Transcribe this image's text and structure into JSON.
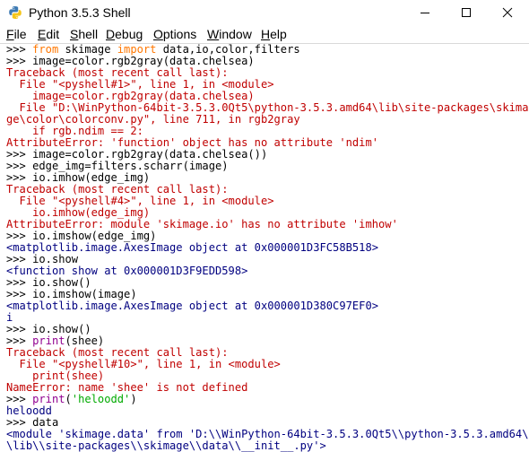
{
  "window": {
    "title": "Python 3.5.3 Shell",
    "icon": "python-icon",
    "controls": [
      "minimize-icon",
      "maximize-icon",
      "close-icon"
    ]
  },
  "menubar": {
    "items": [
      {
        "label": "File",
        "underline": "F"
      },
      {
        "label": "Edit",
        "underline": "E"
      },
      {
        "label": "Shell",
        "underline": "S"
      },
      {
        "label": "Debug",
        "underline": "D"
      },
      {
        "label": "Options",
        "underline": "O"
      },
      {
        "label": "Window",
        "underline": "W"
      },
      {
        "label": "Help",
        "underline": "H"
      }
    ]
  },
  "colors": {
    "prompt": "#000000",
    "keyword": "#ff7700",
    "builtin": "#900090",
    "string": "#00aa00",
    "stdout": "#000080",
    "error": "#c00000"
  },
  "shell": {
    "lines": [
      {
        "kind": "input",
        "prompt": ">>> ",
        "parts": [
          {
            "t": "from",
            "c": "kw"
          },
          {
            "t": " skimage "
          },
          {
            "t": "import",
            "c": "kw"
          },
          {
            "t": " data,io,color,filters"
          }
        ]
      },
      {
        "kind": "input",
        "prompt": ">>> ",
        "parts": [
          {
            "t": "image=color.rgb2gray(data.chelsea)"
          }
        ]
      },
      {
        "kind": "error",
        "text": "Traceback (most recent call last):"
      },
      {
        "kind": "error",
        "text": "  File \"<pyshell#1>\", line 1, in <module>"
      },
      {
        "kind": "error",
        "text": "    image=color.rgb2gray(data.chelsea)"
      },
      {
        "kind": "error",
        "text": "  File \"D:\\WinPython-64bit-3.5.3.0Qt5\\python-3.5.3.amd64\\lib\\site-packages\\skima"
      },
      {
        "kind": "error",
        "text": "ge\\color\\colorconv.py\", line 711, in rgb2gray"
      },
      {
        "kind": "error",
        "text": "    if rgb.ndim == 2:"
      },
      {
        "kind": "error",
        "text": "AttributeError: 'function' object has no attribute 'ndim'"
      },
      {
        "kind": "input",
        "prompt": ">>> ",
        "parts": [
          {
            "t": "image=color.rgb2gray(data.chelsea())"
          }
        ]
      },
      {
        "kind": "input",
        "prompt": ">>> ",
        "parts": [
          {
            "t": "edge_img=filters.scharr(image)"
          }
        ]
      },
      {
        "kind": "input",
        "prompt": ">>> ",
        "parts": [
          {
            "t": "io.imhow(edge_img)"
          }
        ]
      },
      {
        "kind": "error",
        "text": "Traceback (most recent call last):"
      },
      {
        "kind": "error",
        "text": "  File \"<pyshell#4>\", line 1, in <module>"
      },
      {
        "kind": "error",
        "text": "    io.imhow(edge_img)"
      },
      {
        "kind": "error",
        "text": "AttributeError: module 'skimage.io' has no attribute 'imhow'"
      },
      {
        "kind": "input",
        "prompt": ">>> ",
        "parts": [
          {
            "t": "io.imshow(edge_img)"
          }
        ]
      },
      {
        "kind": "stdout",
        "text": "<matplotlib.image.AxesImage object at 0x000001D3FC58B518>"
      },
      {
        "kind": "input",
        "prompt": ">>> ",
        "parts": [
          {
            "t": "io.show"
          }
        ]
      },
      {
        "kind": "stdout",
        "text": "<function show at 0x000001D3F9EDD598>"
      },
      {
        "kind": "input",
        "prompt": ">>> ",
        "parts": [
          {
            "t": "io.show()"
          }
        ]
      },
      {
        "kind": "input",
        "prompt": ">>> ",
        "parts": [
          {
            "t": "io.imshow(image)"
          }
        ]
      },
      {
        "kind": "stdout",
        "text": "<matplotlib.image.AxesImage object at 0x000001D380C97EF0>"
      },
      {
        "kind": "stdout",
        "text": "i"
      },
      {
        "kind": "input",
        "prompt": ">>> ",
        "parts": [
          {
            "t": "io.show()"
          }
        ]
      },
      {
        "kind": "input",
        "prompt": ">>> ",
        "parts": [
          {
            "t": "print",
            "c": "bi"
          },
          {
            "t": "(shee)"
          }
        ]
      },
      {
        "kind": "error",
        "text": "Traceback (most recent call last):"
      },
      {
        "kind": "error",
        "text": "  File \"<pyshell#10>\", line 1, in <module>"
      },
      {
        "kind": "error",
        "text": "    print(shee)"
      },
      {
        "kind": "error",
        "text": "NameError: name 'shee' is not defined"
      },
      {
        "kind": "input",
        "prompt": ">>> ",
        "parts": [
          {
            "t": "print",
            "c": "bi"
          },
          {
            "t": "("
          },
          {
            "t": "'heloodd'",
            "c": "str"
          },
          {
            "t": ")"
          }
        ]
      },
      {
        "kind": "stdout",
        "text": "heloodd"
      },
      {
        "kind": "input",
        "prompt": ">>> ",
        "parts": [
          {
            "t": "data"
          }
        ]
      },
      {
        "kind": "stdout",
        "text": "<module 'skimage.data' from 'D:\\\\WinPython-64bit-3.5.3.0Qt5\\\\python-3.5.3.amd64\\\\"
      },
      {
        "kind": "stdout",
        "text": "\\lib\\\\site-packages\\\\skimage\\\\data\\\\__init__.py'>"
      }
    ]
  }
}
